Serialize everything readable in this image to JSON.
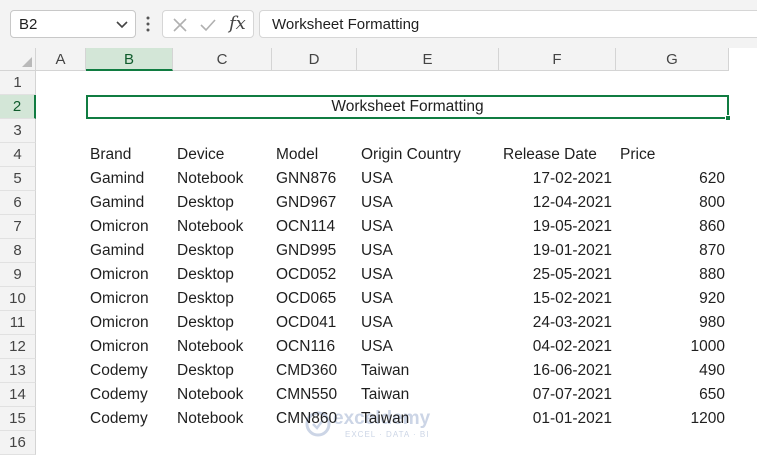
{
  "name_box": {
    "value": "B2"
  },
  "formula_bar": {
    "fx_label": "fx",
    "content": "Worksheet Formatting"
  },
  "columns": [
    "A",
    "B",
    "C",
    "D",
    "E",
    "F",
    "G"
  ],
  "rows": [
    "1",
    "2",
    "3",
    "4",
    "5",
    "6",
    "7",
    "8",
    "9",
    "10",
    "11",
    "12",
    "13",
    "14",
    "15",
    "16"
  ],
  "title_cell": "Worksheet Formatting",
  "table": {
    "headers": [
      "Brand",
      "Device",
      "Model",
      "Origin Country",
      "Release Date",
      "Price"
    ],
    "rows": [
      [
        "Gamind",
        "Notebook",
        "GNN876",
        "USA",
        "17-02-2021",
        "620"
      ],
      [
        "Gamind",
        "Desktop",
        "GND967",
        "USA",
        "12-04-2021",
        "800"
      ],
      [
        "Omicron",
        "Notebook",
        "OCN114",
        "USA",
        "19-05-2021",
        "860"
      ],
      [
        "Gamind",
        "Desktop",
        "GND995",
        "USA",
        "19-01-2021",
        "870"
      ],
      [
        "Omicron",
        "Desktop",
        "OCD052",
        "USA",
        "25-05-2021",
        "880"
      ],
      [
        "Omicron",
        "Desktop",
        "OCD065",
        "USA",
        "15-02-2021",
        "920"
      ],
      [
        "Omicron",
        "Desktop",
        "OCD041",
        "USA",
        "24-03-2021",
        "980"
      ],
      [
        "Omicron",
        "Notebook",
        "OCN116",
        "USA",
        "04-02-2021",
        "1000"
      ],
      [
        "Codemy",
        "Desktop",
        "CMD360",
        "Taiwan",
        "16-06-2021",
        "490"
      ],
      [
        "Codemy",
        "Notebook",
        "CMN550",
        "Taiwan",
        "07-07-2021",
        "650"
      ],
      [
        "Codemy",
        "Notebook",
        "CMN860",
        "Taiwan",
        "01-01-2021",
        "1200"
      ]
    ]
  },
  "watermark": {
    "name": "exceldemy",
    "tagline": "EXCEL · DATA · BI"
  },
  "colors": {
    "accent": "#107c41",
    "header_bg": "#f3f3f3",
    "selected_header_bg": "#d3e6d7"
  }
}
